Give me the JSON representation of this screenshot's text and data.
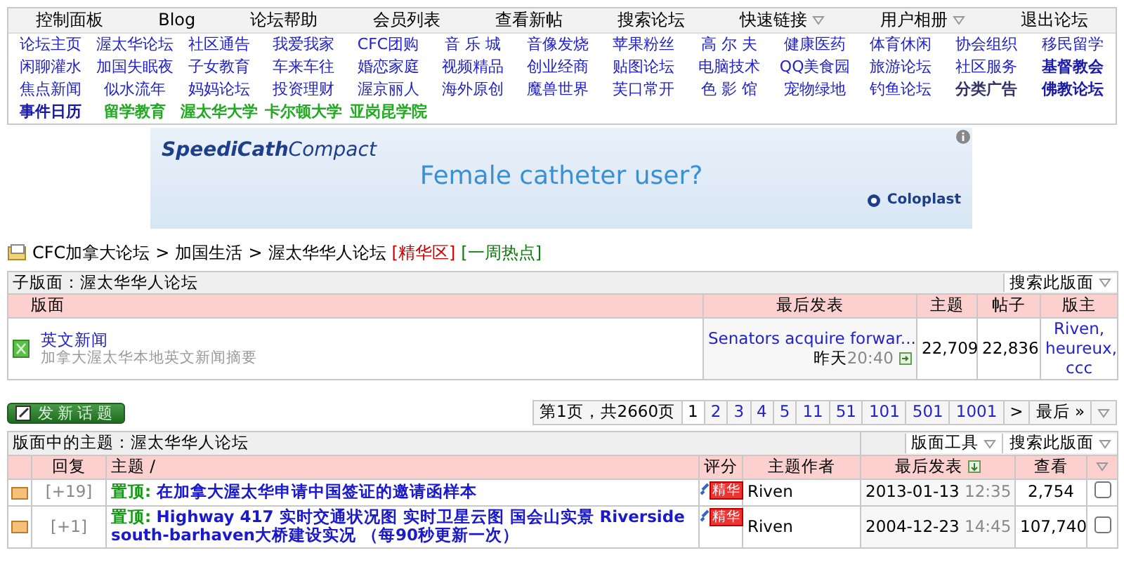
{
  "top_nav": {
    "menu": [
      {
        "label": "控制面板",
        "dropdown": false
      },
      {
        "label": "Blog",
        "dropdown": false
      },
      {
        "label": "论坛帮助",
        "dropdown": false
      },
      {
        "label": "会员列表",
        "dropdown": false
      },
      {
        "label": "查看新帖",
        "dropdown": false
      },
      {
        "label": "搜索论坛",
        "dropdown": false
      },
      {
        "label": "快速链接",
        "dropdown": true
      },
      {
        "label": "用户相册",
        "dropdown": true
      },
      {
        "label": "退出论坛",
        "dropdown": false
      }
    ],
    "links": [
      [
        {
          "label": "论坛主页",
          "kind": "normal"
        },
        {
          "label": "渥太华论坛",
          "kind": "normal"
        },
        {
          "label": "社区通告",
          "kind": "normal"
        },
        {
          "label": "我爱我家",
          "kind": "normal"
        },
        {
          "label": "CFC团购",
          "kind": "normal"
        },
        {
          "label": "音 乐 城",
          "kind": "normal"
        },
        {
          "label": "音像发烧",
          "kind": "normal"
        },
        {
          "label": "苹果粉丝",
          "kind": "normal"
        },
        {
          "label": "高 尔 夫",
          "kind": "normal"
        },
        {
          "label": "健康医药",
          "kind": "normal"
        },
        {
          "label": "体育休闲",
          "kind": "normal"
        },
        {
          "label": "协会组织",
          "kind": "normal"
        },
        {
          "label": "移民留学",
          "kind": "normal"
        }
      ],
      [
        {
          "label": "闲聊灌水",
          "kind": "normal"
        },
        {
          "label": "加国失眠夜",
          "kind": "normal"
        },
        {
          "label": "子女教育",
          "kind": "normal"
        },
        {
          "label": "车来车往",
          "kind": "normal"
        },
        {
          "label": "婚恋家庭",
          "kind": "normal"
        },
        {
          "label": "视频精品",
          "kind": "normal"
        },
        {
          "label": "创业经商",
          "kind": "normal"
        },
        {
          "label": "贴图论坛",
          "kind": "normal"
        },
        {
          "label": "电脑技术",
          "kind": "normal"
        },
        {
          "label": "QQ美食园",
          "kind": "normal"
        },
        {
          "label": "旅游论坛",
          "kind": "normal"
        },
        {
          "label": "社区服务",
          "kind": "normal"
        },
        {
          "label": "基督教会",
          "kind": "bold"
        }
      ],
      [
        {
          "label": "焦点新闻",
          "kind": "normal"
        },
        {
          "label": "似水流年",
          "kind": "normal"
        },
        {
          "label": "妈妈论坛",
          "kind": "normal"
        },
        {
          "label": "投资理财",
          "kind": "normal"
        },
        {
          "label": "渥京丽人",
          "kind": "normal"
        },
        {
          "label": "海外原创",
          "kind": "normal"
        },
        {
          "label": "魔兽世界",
          "kind": "normal"
        },
        {
          "label": "芙口常开",
          "kind": "normal"
        },
        {
          "label": "色 影 馆",
          "kind": "normal"
        },
        {
          "label": "宠物绿地",
          "kind": "normal"
        },
        {
          "label": "钓鱼论坛",
          "kind": "normal"
        },
        {
          "label": "分类广告",
          "kind": "dark"
        },
        {
          "label": "佛教论坛",
          "kind": "bold"
        }
      ],
      [
        {
          "label": "事件日历",
          "kind": "bold"
        },
        {
          "label": "留学教育",
          "kind": "green"
        },
        {
          "label": "渥太华大学",
          "kind": "green"
        },
        {
          "label": "卡尔顿大学",
          "kind": "green"
        },
        {
          "label": "亚岗昆学院",
          "kind": "green"
        }
      ]
    ]
  },
  "ad": {
    "brand": "SpeediCath",
    "product": "Compact",
    "headline": "Female catheter user?",
    "advertiser": "Coloplast"
  },
  "breadcrumb": {
    "items": [
      {
        "label": "CFC加拿大论坛",
        "separator": ">"
      },
      {
        "label": "加国生活",
        "separator": ">"
      }
    ],
    "current": "渥太华华人论坛",
    "tags": [
      {
        "label": "[精华区]",
        "color": "#cc0000"
      },
      {
        "label": "[一周热点]",
        "color": "#117711"
      }
    ]
  },
  "subforums": {
    "title": "子版面：渥太华华人论坛",
    "search": "搜索此版面",
    "columns": [
      "版面",
      "最后发表",
      "主题",
      "帖子",
      "版主"
    ],
    "rows": [
      {
        "name": "英文新闻",
        "description": "加拿大渥太华本地英文新闻摘要",
        "last_post": "Senators acquire forwar...",
        "last_day": "昨天",
        "last_time": "20:40",
        "topics": "22,709",
        "posts": "22,836",
        "moderators": "Riven, heureux, ccc"
      }
    ]
  },
  "new_topic_button": "发新话题",
  "pagination": {
    "summary": "第1页，共2660页",
    "pages": [
      {
        "label": "1",
        "selected": true
      },
      {
        "label": "2",
        "selected": false
      },
      {
        "label": "3",
        "selected": false
      },
      {
        "label": "4",
        "selected": false
      },
      {
        "label": "5",
        "selected": false
      },
      {
        "label": "11",
        "selected": false
      },
      {
        "label": "51",
        "selected": false
      },
      {
        "label": "101",
        "selected": false
      },
      {
        "label": "501",
        "selected": false
      },
      {
        "label": "1001",
        "selected": false
      }
    ],
    "next": ">",
    "last": "最后 »"
  },
  "topics": {
    "title": "版面中的主题：渥太华华人论坛",
    "tools": [
      "版面工具",
      "搜索此版面"
    ],
    "columns": [
      "回复",
      "主题 /",
      "评分",
      "主题作者",
      "最后发表",
      "查看"
    ],
    "rows": [
      {
        "replies": "[+19]",
        "prefix": "置顶:",
        "title": "在加拿大渥太华申请中国签证的邀请函样本",
        "tag": "精华",
        "author": "Riven",
        "date": "2013-01-13",
        "time": "12:35",
        "views": "2,754",
        "checked": false
      },
      {
        "replies": "[+1]",
        "prefix": "置顶:",
        "title": "Highway 417 实时交通状况图 实时卫星云图 国会山实景 Riverside south-barhaven大桥建设实况 （每90秒更新一次）",
        "tag": "精华",
        "author": "Riven",
        "date": "2004-12-23",
        "time": "14:45",
        "views": "107,740",
        "checked": false
      }
    ]
  }
}
